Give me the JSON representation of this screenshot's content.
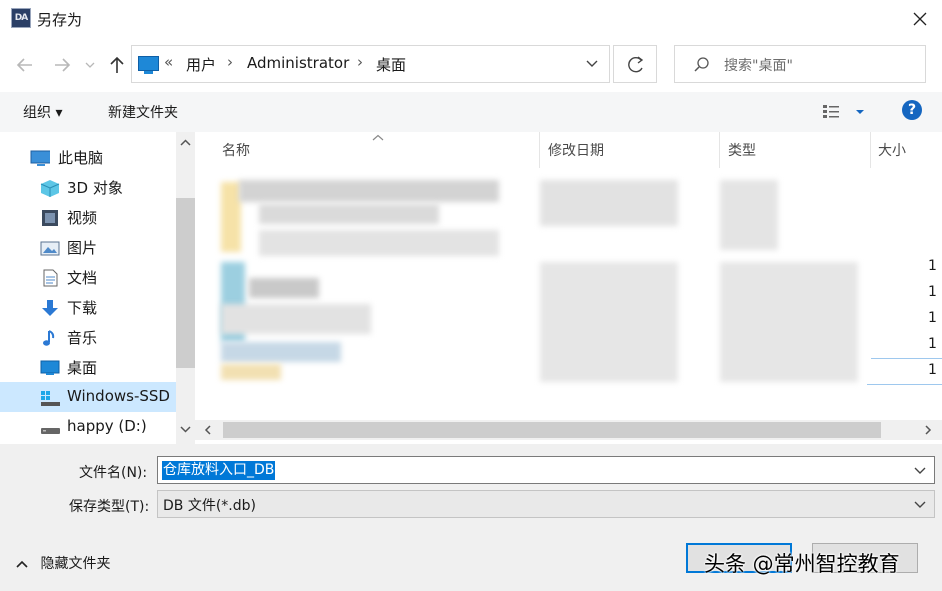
{
  "window": {
    "title": "另存为",
    "app_icon_text": "DA"
  },
  "address": {
    "overflow": "«",
    "crumbs": [
      "用户",
      "Administrator",
      "桌面"
    ],
    "separator": "›"
  },
  "search": {
    "placeholder": "搜索\"桌面\""
  },
  "toolbar": {
    "organize_label": "组织 ▾",
    "new_folder_label": "新建文件夹",
    "help_label": "?"
  },
  "nav": {
    "items": [
      {
        "label": "此电脑",
        "icon": "computer-icon"
      },
      {
        "label": "3D 对象",
        "icon": "cube-icon"
      },
      {
        "label": "视频",
        "icon": "video-icon"
      },
      {
        "label": "图片",
        "icon": "picture-icon"
      },
      {
        "label": "文档",
        "icon": "document-icon"
      },
      {
        "label": "下载",
        "icon": "download-icon"
      },
      {
        "label": "音乐",
        "icon": "music-icon"
      },
      {
        "label": "桌面",
        "icon": "desktop-icon"
      },
      {
        "label": "Windows-SSD",
        "icon": "drive-icon",
        "selected": true
      },
      {
        "label": "happy (D:)",
        "icon": "drive-icon"
      }
    ]
  },
  "columns": {
    "name": "名称",
    "modified": "修改日期",
    "type": "类型",
    "size": "大小"
  },
  "size_partials": [
    "1",
    "1",
    "1",
    "1",
    "1"
  ],
  "form": {
    "filename_label": "文件名(N):",
    "filename_value": "仓库放料入口_DB",
    "filetype_label": "保存类型(T):",
    "filetype_value": "DB 文件(*.db)"
  },
  "bottom": {
    "hide_folders_label": "隐藏文件夹"
  },
  "watermark": "头条 @常州智控教育",
  "colors": {
    "accent": "#0078d7",
    "help": "#1566c0",
    "selected_nav": "#cce8ff"
  }
}
